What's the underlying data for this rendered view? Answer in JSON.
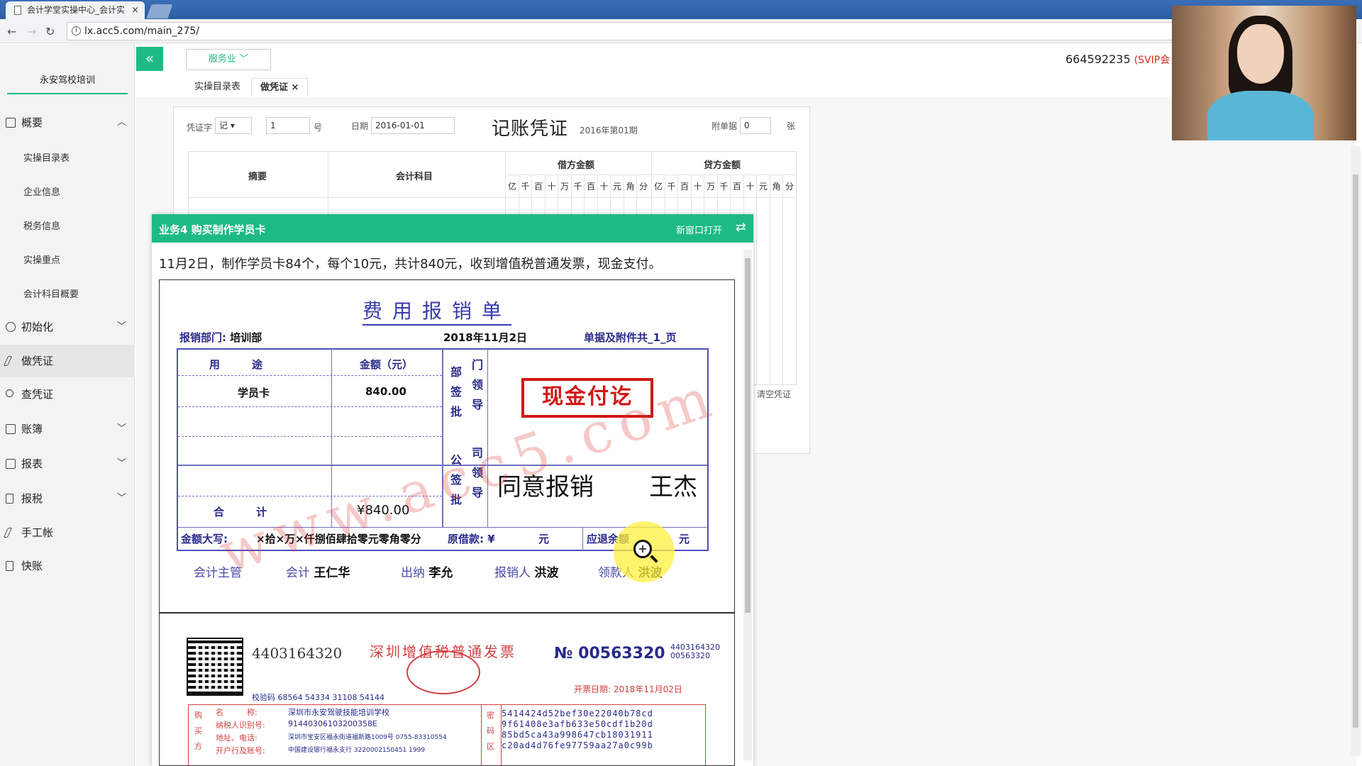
{
  "browser": {
    "tab_title": "会计学堂实操中心_会计实",
    "tab_close": "×",
    "url": "lx.acc5.com/main_275/",
    "back": "←",
    "forward": "→",
    "reload": "↻",
    "info_icon": "i"
  },
  "sidebar": {
    "school": "永安驾校培训",
    "groups": [
      {
        "label": "概要",
        "icon": "overview-icon",
        "expanded": true
      },
      {
        "label": "初始化",
        "icon": "gear-icon"
      },
      {
        "label": "做凭证",
        "icon": "pen-icon",
        "active": true
      },
      {
        "label": "查凭证",
        "icon": "search-icon"
      },
      {
        "label": "账簿",
        "icon": "book-icon"
      },
      {
        "label": "报表",
        "icon": "report-icon"
      },
      {
        "label": "报税",
        "icon": "file-icon"
      },
      {
        "label": "手工帐",
        "icon": "pen-icon"
      },
      {
        "label": "快账",
        "icon": "file-icon"
      }
    ],
    "overview_items": [
      "实操目录表",
      "企业信息",
      "税务信息",
      "实操重点",
      "会计科目概要"
    ],
    "chevron_up": "︿",
    "chevron_down": "﹀"
  },
  "topbar": {
    "collapse": "«",
    "industry": "服务业 ﹀",
    "account_id": "664592235",
    "account_level": "(SVIP会"
  },
  "app_tabs": [
    {
      "label": "实操目录表"
    },
    {
      "label": "做凭证",
      "close": "×",
      "active": true
    }
  ],
  "voucher": {
    "word_label": "凭证字",
    "word_value": "记",
    "number_value": "1",
    "number_suffix": "号",
    "date_label": "日期",
    "date_value": "2016-01-01",
    "title": "记账凭证",
    "period": "2016年第01期",
    "attach_label": "附单据",
    "attach_value": "0",
    "attach_unit": "张",
    "col_summary": "摘要",
    "col_account": "会计科目",
    "col_debit": "借方金额",
    "col_credit": "贷方金额",
    "digits": [
      "亿",
      "千",
      "百",
      "十",
      "万",
      "千",
      "百",
      "十",
      "元",
      "角",
      "分"
    ],
    "clear_btn": "清空凭证"
  },
  "task": {
    "title": "业务4 购买制作学员卡",
    "open_new": "新窗口打开",
    "swap_icon": "⇄",
    "description": "11月2日，制作学员卡84个，每个10元，共计840元，收到增值税普通发票，现金支付。"
  },
  "expense_form": {
    "title": "费用报销单",
    "dept_label": "报销部门:",
    "dept_value": "培训部",
    "date": "2018年11月2日",
    "attach": "单据及附件共_1_页",
    "col_use": "用　　　途",
    "col_amount": "金额（元）",
    "dept_approve": [
      "部",
      "门",
      "签",
      "领",
      "批",
      "导"
    ],
    "company_approve": [
      "公",
      "司",
      "签",
      "领",
      "批",
      "导"
    ],
    "row_item": "学员卡",
    "row_amount": "840.00",
    "total_label": "合　　　计",
    "total_amount": "¥840.00",
    "stamp": "现金付讫",
    "approval_text": "同意报销",
    "approver": "王杰",
    "amount_words_label": "金额大写:",
    "amount_words": "×拾×万×仟捌佰肆拾零元零角零分",
    "loan_label": "原借款: ¥",
    "loan_unit": "元",
    "refund_label": "应退余额",
    "refund_unit": "元",
    "sig_manager": "会计主管",
    "sig_accountant_label": "会计",
    "sig_accountant": "王仁华",
    "sig_cashier_label": "出纳",
    "sig_cashier": "李允",
    "sig_claimant_label": "报销人",
    "sig_claimant": "洪波",
    "sig_receiver_label": "领款人",
    "sig_receiver": "洪波",
    "watermark": "www.acc5.com",
    "zoom_icon": "+"
  },
  "invoice": {
    "code": "4403164320",
    "title": "深圳增值税普通发票",
    "no_label": "№",
    "no_value": "00563320",
    "code_small_1": "4403164320",
    "code_small_2": "00563320",
    "issue_date": "开票日期: 2018年11月02日",
    "check_code": "校验码 68564 54334 31108 54144",
    "buyer_name_label": "名　　　称:",
    "buyer_name": "深圳市永安驾驶技能培训学校",
    "buyer_taxid_label": "纳税人识别号:",
    "buyer_taxid": "91440306103200358E",
    "buyer_addr_label": "地址、电话:",
    "buyer_addr": "深圳市宝安区福永街道福新路1009号 0755-83310554",
    "buyer_bank_label": "开户行及账号:",
    "buyer_bank": "中国建设银行福永支行 3220002150451 1999",
    "buyer_side": [
      "购",
      "买",
      "方"
    ],
    "pwd_side": [
      "密",
      "码",
      "区"
    ],
    "pwd_lines": [
      "5414424d52bef30e22040b78cd",
      "9f61408e3afb633e50cdf1b20d",
      "85bd5ca43a998647cb18031911",
      "c20ad4d76fe97759aa27a0c99b"
    ]
  }
}
